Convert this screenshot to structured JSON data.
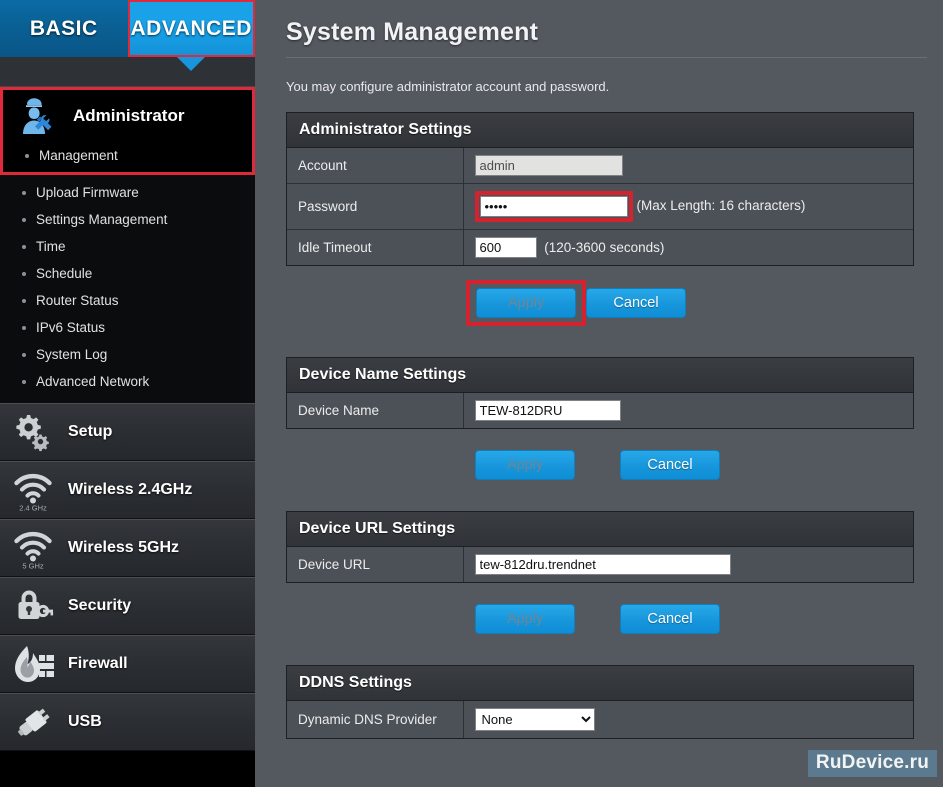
{
  "tabs": {
    "basic": "BASIC",
    "advanced": "ADVANCED"
  },
  "sidebar": {
    "active_group": {
      "label": "Administrator",
      "icon": "administrator-icon",
      "items": [
        {
          "label": "Management",
          "active": true
        },
        {
          "label": "Upload Firmware",
          "active": false
        },
        {
          "label": "Settings Management",
          "active": false
        },
        {
          "label": "Time",
          "active": false
        },
        {
          "label": "Schedule",
          "active": false
        },
        {
          "label": "Router Status",
          "active": false
        },
        {
          "label": "IPv6 Status",
          "active": false
        },
        {
          "label": "System Log",
          "active": false
        },
        {
          "label": "Advanced Network",
          "active": false
        }
      ]
    },
    "groups": [
      {
        "label": "Setup",
        "icon": "gears-icon",
        "badge": ""
      },
      {
        "label": "Wireless 2.4GHz",
        "icon": "wifi-icon",
        "badge": "2.4 GHz"
      },
      {
        "label": "Wireless 5GHz",
        "icon": "wifi-icon",
        "badge": "5 GHz"
      },
      {
        "label": "Security",
        "icon": "lock-key-icon",
        "badge": ""
      },
      {
        "label": "Firewall",
        "icon": "firewall-flame-icon",
        "badge": ""
      },
      {
        "label": "USB",
        "icon": "usb-icon",
        "badge": ""
      }
    ]
  },
  "main": {
    "title": "System Management",
    "description": "You may configure administrator account and password.",
    "admin_panel": {
      "heading": "Administrator Settings",
      "rows": [
        {
          "label": "Account",
          "value": "admin",
          "hint": ""
        },
        {
          "label": "Password",
          "value": "•••••",
          "hint": "(Max Length: 16 characters)"
        },
        {
          "label": "Idle Timeout",
          "value": "600",
          "hint": "(120-3600 seconds)"
        }
      ],
      "apply_label": "Apply",
      "cancel_label": "Cancel"
    },
    "device_name_panel": {
      "heading": "Device Name Settings",
      "row_label": "Device Name",
      "value": "TEW-812DRU",
      "apply_label": "Apply",
      "cancel_label": "Cancel"
    },
    "device_url_panel": {
      "heading": "Device URL Settings",
      "row_label": "Device URL",
      "value": "tew-812dru.trendnet",
      "apply_label": "Apply",
      "cancel_label": "Cancel"
    },
    "ddns_panel": {
      "heading": "DDNS Settings",
      "row_label": "Dynamic DNS Provider",
      "selected": "None",
      "options": [
        "None"
      ]
    }
  },
  "watermark": "RuDevice.ru",
  "colors": {
    "accent_blue": "#18a2ea",
    "tab_basic_blue": "#0a5f93",
    "highlight_red": "#e02a3c",
    "panel_bg": "#4c5057",
    "page_bg": "#54585f",
    "sidebar_bg": "#000000",
    "watermark_bg": "#5d7d93"
  }
}
